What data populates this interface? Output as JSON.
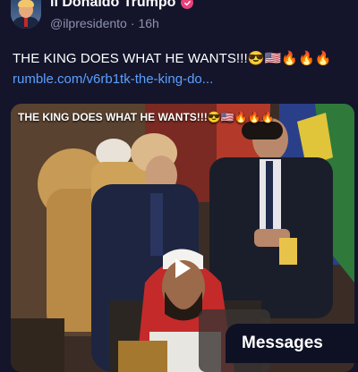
{
  "post": {
    "display_name": "il Donaldo Trumpo",
    "handle": "@ilpresidento",
    "separator": "·",
    "time_ago": "16h",
    "text": "THE KING DOES WHAT HE WANTS!!!😎🇺🇸🔥🔥🔥",
    "link": "rumble.com/v6rb1tk-the-king-do..."
  },
  "video": {
    "title_overlay": "THE KING DOES WHAT HE WANTS!!!😎🇺🇸🔥🔥🔥"
  },
  "messages": {
    "label": "Messages"
  },
  "colors": {
    "background": "#14152b",
    "link": "#5ba0ff",
    "verified_badge": "#e9417a",
    "secondary_text": "#8e92ad"
  },
  "icons": {
    "verified": "verified-badge-icon",
    "play": "play-icon"
  }
}
